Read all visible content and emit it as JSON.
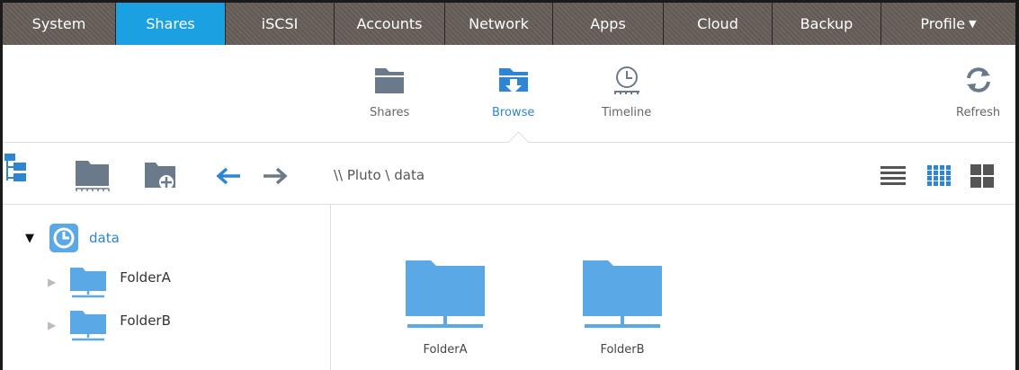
{
  "nav": {
    "tabs": [
      {
        "label": "System"
      },
      {
        "label": "Shares"
      },
      {
        "label": "iSCSI"
      },
      {
        "label": "Accounts"
      },
      {
        "label": "Network"
      },
      {
        "label": "Apps"
      },
      {
        "label": "Cloud"
      },
      {
        "label": "Backup"
      },
      {
        "label": "Profile"
      }
    ],
    "active": "Shares",
    "active_color": "#1ba1e2"
  },
  "toolbar": {
    "shares_label": "Shares",
    "browse_label": "Browse",
    "timeline_label": "Timeline",
    "refresh_label": "Refresh",
    "active": "Browse"
  },
  "browse": {
    "path": "\\\\ Pluto \\ data"
  },
  "tree": {
    "root": "data",
    "children": [
      "FolderA",
      "FolderB"
    ]
  },
  "content": {
    "items": [
      "FolderA",
      "FolderB"
    ]
  },
  "colors": {
    "folder_blue": "#5aa8e6",
    "accent_blue": "#2d85d4"
  }
}
